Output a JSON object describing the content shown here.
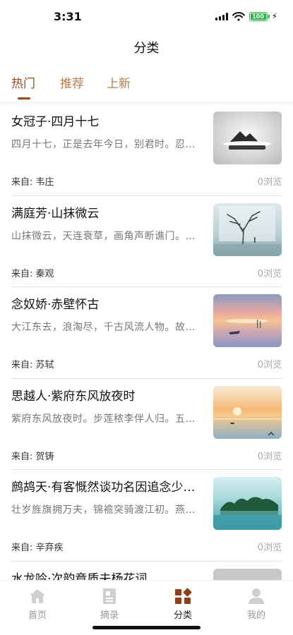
{
  "status_bar": {
    "time": "3:31",
    "battery": "100"
  },
  "header": {
    "title": "分类"
  },
  "tabs": [
    {
      "label": "热门",
      "active": true
    },
    {
      "label": "推荐",
      "active": false
    },
    {
      "label": "上新",
      "active": false
    }
  ],
  "items": [
    {
      "title": "女冠子·四月十七",
      "excerpt": "四月十七，正是去年今日，别君时。忍…",
      "source_label": "来自:",
      "author": "韦庄",
      "views": "0浏览",
      "thumb": "mountain-mist"
    },
    {
      "title": "满庭芳·山抹微云",
      "excerpt": "山抹微云，天连衰草，画角声断谯门。…",
      "source_label": "来自:",
      "author": "秦观",
      "views": "0浏览",
      "thumb": "lone-tree"
    },
    {
      "title": "念奴娇·赤壁怀古",
      "excerpt": "大江东去，浪淘尽，千古风流人物。故…",
      "source_label": "来自:",
      "author": "苏轼",
      "views": "0浏览",
      "thumb": "boat-sunset"
    },
    {
      "title": "思越人·紫府东风放夜时",
      "excerpt": "紫府东风放夜时。步莲秾李伴人归。五…",
      "source_label": "来自:",
      "author": "贺铸",
      "views": "0浏览",
      "thumb": "sea-sunset"
    },
    {
      "title": "鹧鸪天·有客慨然谈功名因追念少…",
      "excerpt": "壮岁旌旗拥万夫，锦襜突骑渡江初。燕…",
      "source_label": "来自:",
      "author": "辛弃疾",
      "views": "0浏览",
      "thumb": "lake-island"
    },
    {
      "title": "水龙吟·次韵章质夫杨花词",
      "excerpt": "",
      "source_label": "",
      "author": "",
      "views": "",
      "thumb": "grey"
    }
  ],
  "tabbar": [
    {
      "label": "首页",
      "icon": "home-icon",
      "active": false
    },
    {
      "label": "摘录",
      "icon": "notebook-icon",
      "active": false
    },
    {
      "label": "分类",
      "icon": "category-icon",
      "active": true
    },
    {
      "label": "我的",
      "icon": "user-icon",
      "active": false
    }
  ],
  "colors": {
    "accent": "#9c4a1c",
    "tab_inactive": "#b57b4b",
    "battery": "#29b34a"
  }
}
